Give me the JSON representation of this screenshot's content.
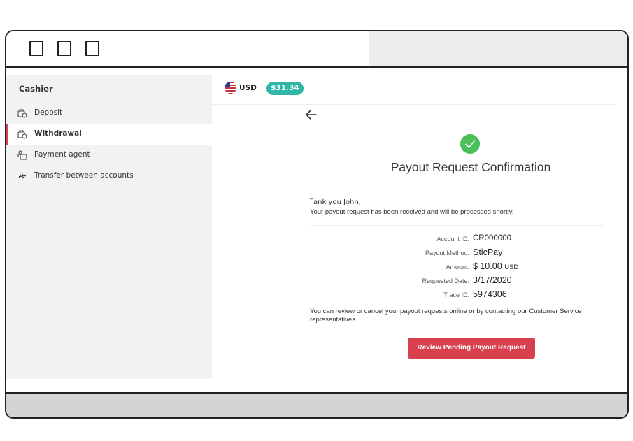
{
  "colors": {
    "accent": "#d9404d",
    "balance_badge": "#2fb6a7",
    "success": "#4bbf5a",
    "sidebar_bg": "#f2f2f2"
  },
  "window": {
    "controls": [
      "square-button",
      "square-button",
      "square-button"
    ]
  },
  "sidebar": {
    "title": "Cashier",
    "items": [
      {
        "label": "Deposit",
        "icon": "deposit-icon",
        "active": false
      },
      {
        "label": "Withdrawal",
        "icon": "withdrawal-icon",
        "active": true
      },
      {
        "label": "Payment agent",
        "icon": "payment-agent-icon",
        "active": false
      },
      {
        "label": "Transfer between accounts",
        "icon": "transfer-icon",
        "active": false
      }
    ]
  },
  "header": {
    "flag_icon": "us-flag-icon",
    "currency": "USD",
    "balance": "$31.34"
  },
  "confirmation": {
    "back_icon": "arrow-left-icon",
    "success_icon": "checkmark-icon",
    "title": "Payout Request Confirmation",
    "greeting": "‾ank you John,",
    "message": "Your payout request has been received and will be processed shortly.",
    "details": [
      {
        "label": "Account ID:",
        "value": "CR000000"
      },
      {
        "label": "Payout Method:",
        "value": "SticPay"
      },
      {
        "label": "Amount:",
        "value": "$ 10.00",
        "unit": "USD"
      },
      {
        "label": "Requested Date:",
        "value": "3/17/2020"
      },
      {
        "label": "Trace ID:",
        "value": "5974306"
      }
    ],
    "review_text": "You can review or cancel your payout requests online or by contacting our Customer Service representatives.",
    "button_label": "Review Pending Payout Request"
  }
}
